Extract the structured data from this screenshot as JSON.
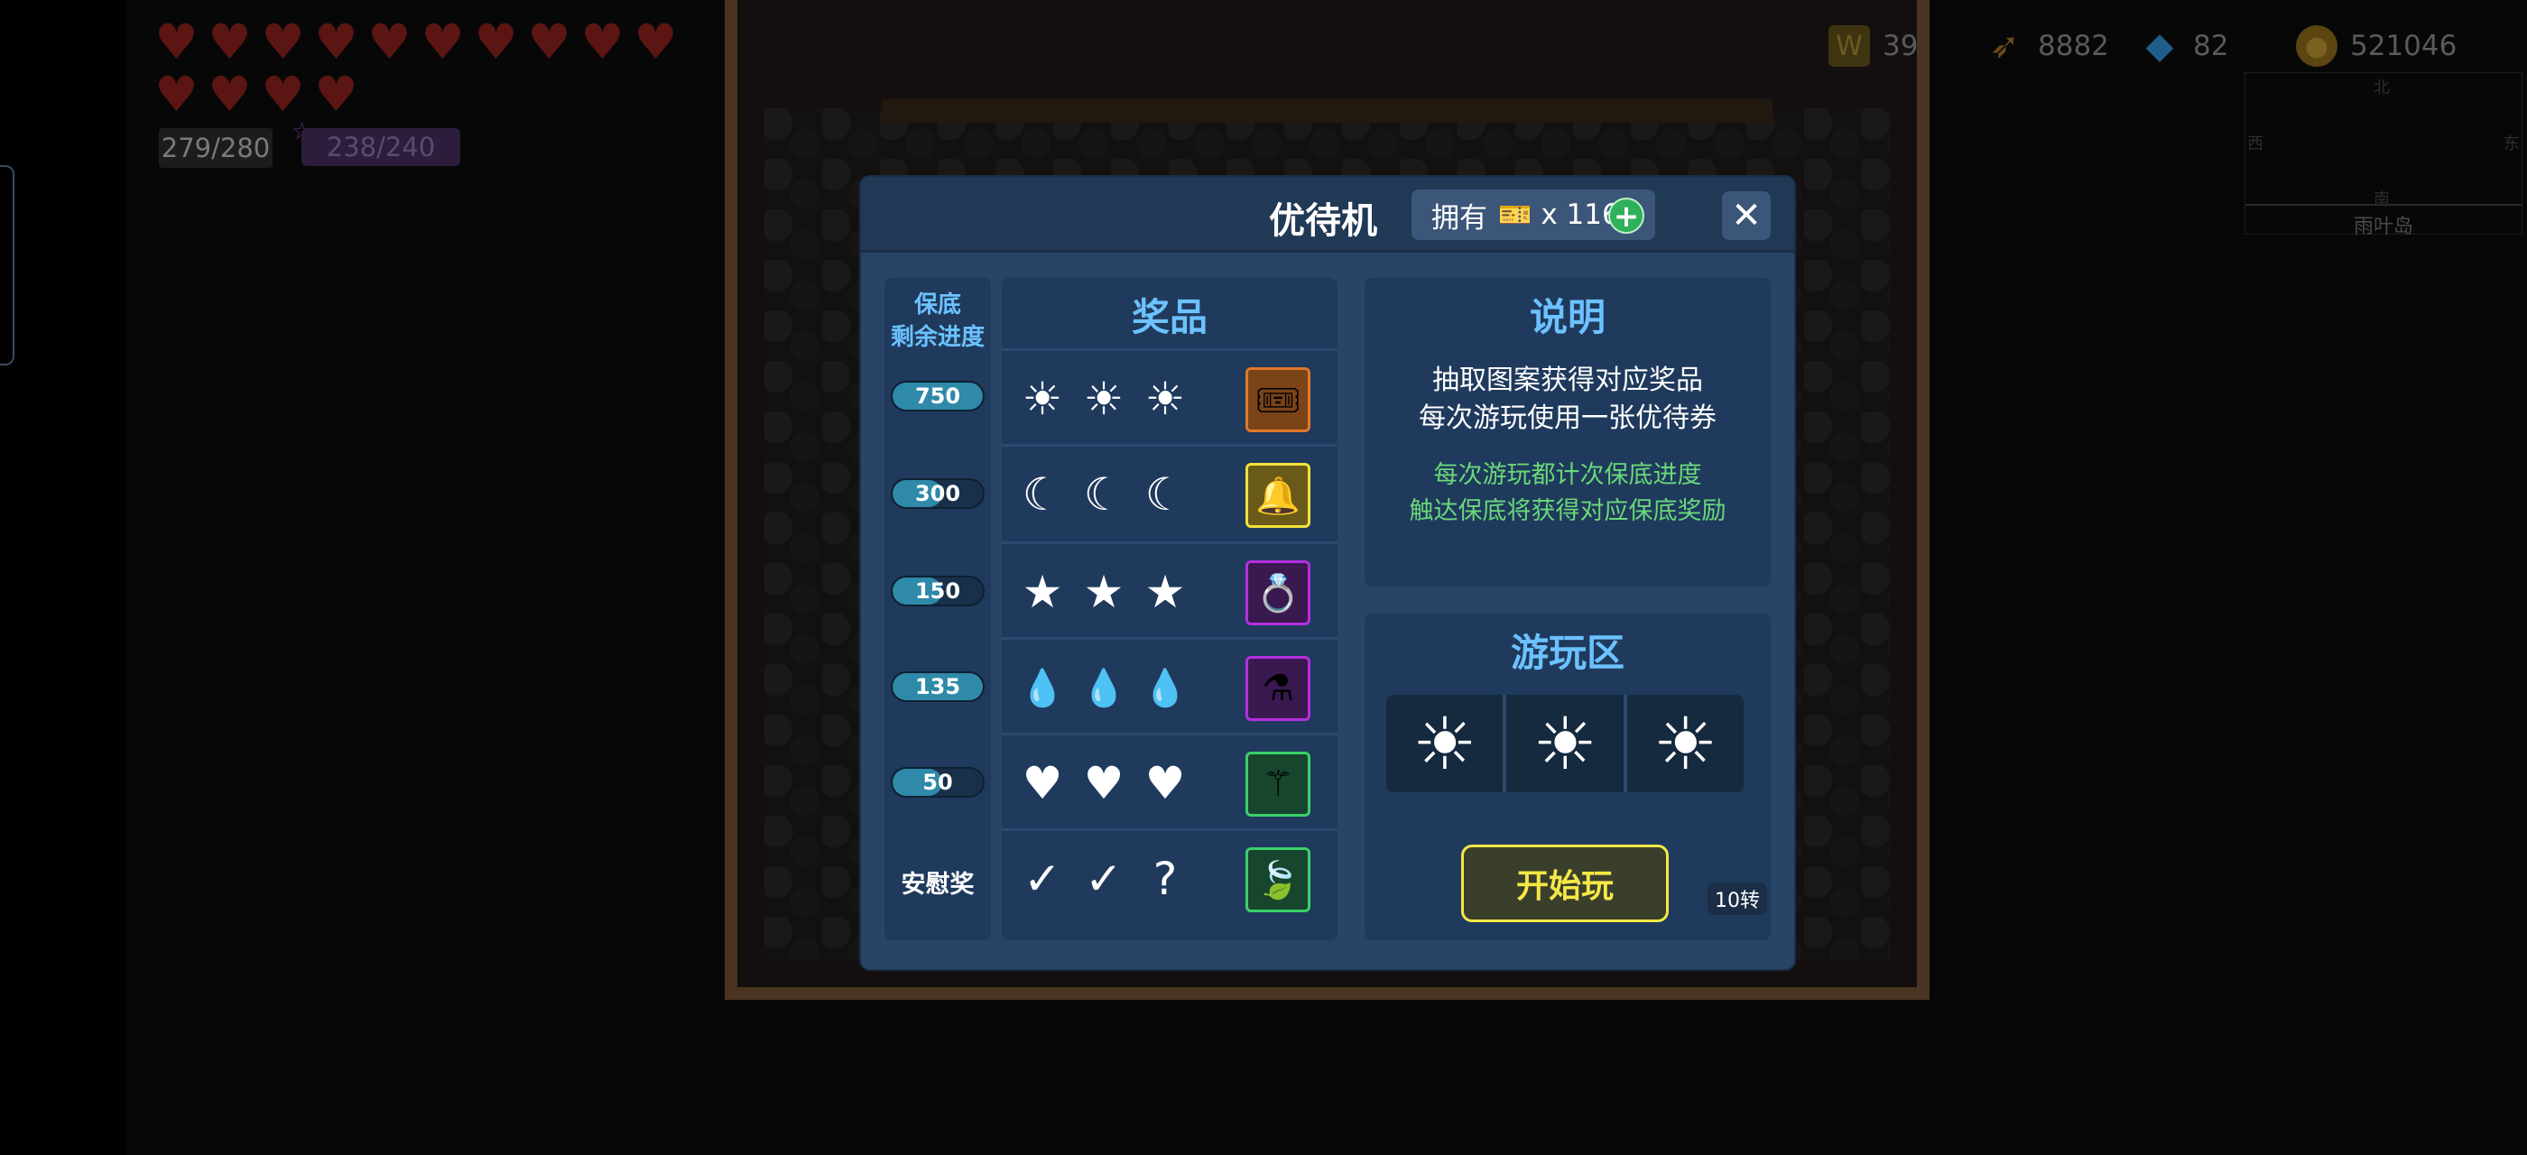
{
  "hud": {
    "hearts": [
      "♥",
      "♥",
      "♥",
      "♥",
      "♥",
      "♥",
      "♥",
      "♥",
      "♥",
      "♥",
      "♥",
      "♥",
      "♥",
      "♥"
    ],
    "hp": "279/280",
    "mana": "238/240",
    "resources": {
      "crown_count": "39",
      "bow_count": "8882",
      "gem_count": "82",
      "gold_count": "521046"
    },
    "minimap": {
      "north": "北",
      "west": "西",
      "east": "东",
      "south": "南",
      "location": "雨叶岛"
    }
  },
  "dialog": {
    "title": "优待机",
    "own_label": "拥有",
    "own_count": "x 116",
    "guarantee": {
      "header_line1": "保底",
      "header_line2": "剩余进度",
      "values": [
        "750",
        "300",
        "150",
        "135",
        "50"
      ],
      "consolation": "安慰奖"
    },
    "prizes": {
      "header": "奖品",
      "rows": [
        {
          "symbols": [
            "☀",
            "☀",
            "☀"
          ],
          "item_icon": "ticket-icon"
        },
        {
          "symbols": [
            "☾",
            "☾",
            "☾"
          ],
          "item_icon": "bell-icon"
        },
        {
          "symbols": [
            "★",
            "★",
            "★"
          ],
          "item_icon": "ring-icon"
        },
        {
          "symbols": [
            "💧",
            "💧",
            "💧"
          ],
          "item_icon": "potion-icon"
        },
        {
          "symbols": [
            "♥",
            "♥",
            "♥"
          ],
          "item_icon": "wand-icon"
        },
        {
          "symbols": [
            "✓",
            "✓",
            "?"
          ],
          "item_icon": "leaf-icon"
        }
      ]
    },
    "description": {
      "header": "说明",
      "line1": "抽取图案获得对应奖品",
      "line2": "每次游玩使用一张优待券",
      "note1": "每次游玩都计次保底进度",
      "note2": "触达保底将获得对应保底奖励"
    },
    "play": {
      "header": "游玩区",
      "reels": [
        "☀",
        "☀",
        "☀"
      ],
      "start_label": "开始玩",
      "turns_badge": "10转"
    }
  },
  "colors": {
    "dialog_bg": "#284466",
    "panel_bg": "#1f3a5c",
    "accent_blue": "#6cc1ff",
    "note_green": "#6ad87a",
    "start_yellow": "#f4e846"
  }
}
